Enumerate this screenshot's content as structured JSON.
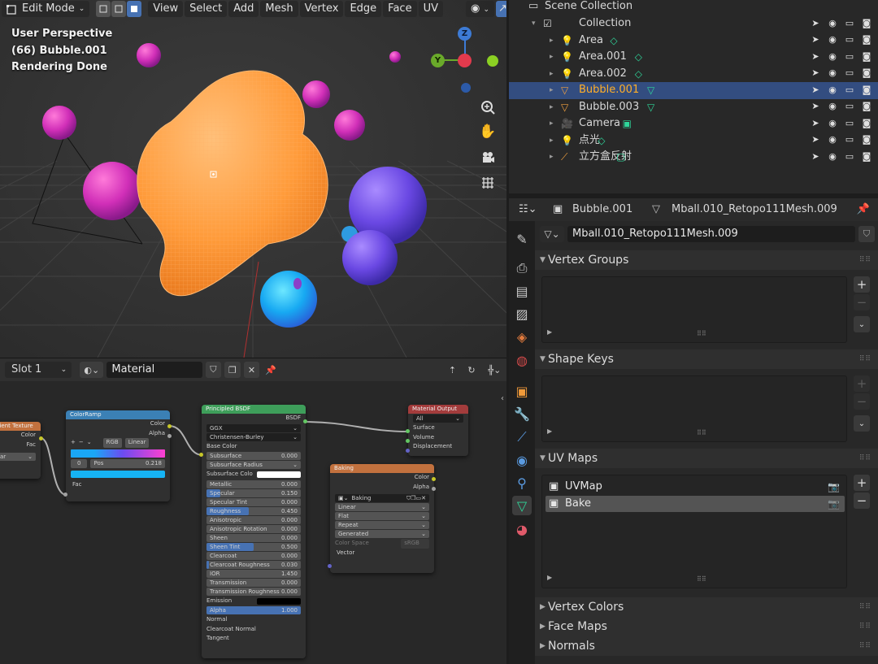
{
  "viewport": {
    "header": {
      "mode": "Edit Mode",
      "menus": [
        "View",
        "Select",
        "Add",
        "Mesh",
        "Vertex",
        "Edge",
        "Face",
        "UV"
      ]
    },
    "info": [
      "User Perspective",
      "(66) Bubble.001",
      "Rendering Done"
    ],
    "gizmo": {
      "z": "Z",
      "y": "Y"
    }
  },
  "node_editor": {
    "header": {
      "slot": "Slot 1",
      "material": "Material"
    },
    "nodes": {
      "gradient": {
        "title": "dient Texture",
        "outputs": [
          "Color",
          "Fac"
        ],
        "field": "ar",
        "field2": "r"
      },
      "colorramp": {
        "title": "ColorRamp",
        "outputs": [
          "Color",
          "Alpha"
        ],
        "mode": "RGB",
        "interp": "Linear",
        "index": "0",
        "pos_label": "Pos",
        "pos_value": "0.218",
        "input": "Fac"
      },
      "bsdf": {
        "title": "Principled BSDF",
        "output": "BSDF",
        "dist": "GGX",
        "sss_method": "Christensen-Burley",
        "base_color": "Base Color",
        "rows": [
          {
            "label": "Subsurface",
            "value": "0.000",
            "fill": 0
          },
          {
            "label": "Subsurface Radius",
            "value": "",
            "fill": 0,
            "dropdown": true
          },
          {
            "label": "Subsurface Colo",
            "value": "",
            "fill": 0,
            "swatch": "#ffffff"
          },
          {
            "label": "Metallic",
            "value": "0.000",
            "fill": 0
          },
          {
            "label": "Specular",
            "value": "0.150",
            "fill": 0.15
          },
          {
            "label": "Specular Tint",
            "value": "0.000",
            "fill": 0
          },
          {
            "label": "Roughness",
            "value": "0.450",
            "fill": 0.45
          },
          {
            "label": "Anisotropic",
            "value": "0.000",
            "fill": 0
          },
          {
            "label": "Anisotropic Rotation",
            "value": "0.000",
            "fill": 0
          },
          {
            "label": "Sheen",
            "value": "0.000",
            "fill": 0
          },
          {
            "label": "Sheen Tint",
            "value": "0.500",
            "fill": 0.5
          },
          {
            "label": "Clearcoat",
            "value": "0.000",
            "fill": 0
          },
          {
            "label": "Clearcoat Roughness",
            "value": "0.030",
            "fill": 0.03
          },
          {
            "label": "IOR",
            "value": "1.450",
            "fill": 0
          },
          {
            "label": "Transmission",
            "value": "0.000",
            "fill": 0
          },
          {
            "label": "Transmission Roughness",
            "value": "0.000",
            "fill": 0
          },
          {
            "label": "Emission",
            "value": "",
            "fill": 0,
            "swatch": "#000000"
          },
          {
            "label": "Alpha",
            "value": "1.000",
            "fill": 1
          }
        ],
        "inputs": [
          "Normal",
          "Clearcoat Normal",
          "Tangent"
        ]
      },
      "output": {
        "title": "Material Output",
        "target": "All",
        "inputs": [
          "Surface",
          "Volume",
          "Displacement"
        ]
      },
      "baking": {
        "title": "Baking",
        "outputs": [
          "Color",
          "Alpha"
        ],
        "image": "Baking",
        "options": [
          "Linear",
          "Flat",
          "Repeat",
          "Generated"
        ],
        "color_space_label": "Color Space",
        "color_space": "sRGB",
        "input": "Vector"
      }
    }
  },
  "outliner": {
    "root": "Scene Collection",
    "items": [
      {
        "name": "Collection",
        "indent": 0,
        "type": "collection"
      },
      {
        "name": "Area",
        "indent": 1,
        "type": "light",
        "sel": false
      },
      {
        "name": "Area.001",
        "indent": 1,
        "type": "light",
        "sel": false
      },
      {
        "name": "Area.002",
        "indent": 1,
        "type": "light",
        "sel": false
      },
      {
        "name": "Bubble.001",
        "indent": 1,
        "type": "mesh",
        "sel": true
      },
      {
        "name": "Bubble.003",
        "indent": 1,
        "type": "mesh",
        "sel": false
      },
      {
        "name": "Camera",
        "indent": 1,
        "type": "camera",
        "sel": false
      },
      {
        "name": "点光",
        "indent": 1,
        "type": "light",
        "sel": false
      },
      {
        "name": "立方盒反射",
        "indent": 1,
        "type": "probe",
        "sel": false
      }
    ]
  },
  "properties": {
    "object": "Bubble.001",
    "mesh": "Mball.010_Retopo111Mesh.009",
    "datablock": "Mball.010_Retopo111Mesh.009",
    "panels": {
      "vertex_groups": "Vertex Groups",
      "shape_keys": "Shape Keys",
      "uv_maps": "UV Maps",
      "vertex_colors": "Vertex Colors",
      "face_maps": "Face Maps",
      "normals": "Normals"
    },
    "uv_maps": [
      "UVMap",
      "Bake"
    ]
  },
  "colors": {
    "accent": "#4772b3",
    "selection": "#334d80",
    "orange": "#ffa53b"
  }
}
